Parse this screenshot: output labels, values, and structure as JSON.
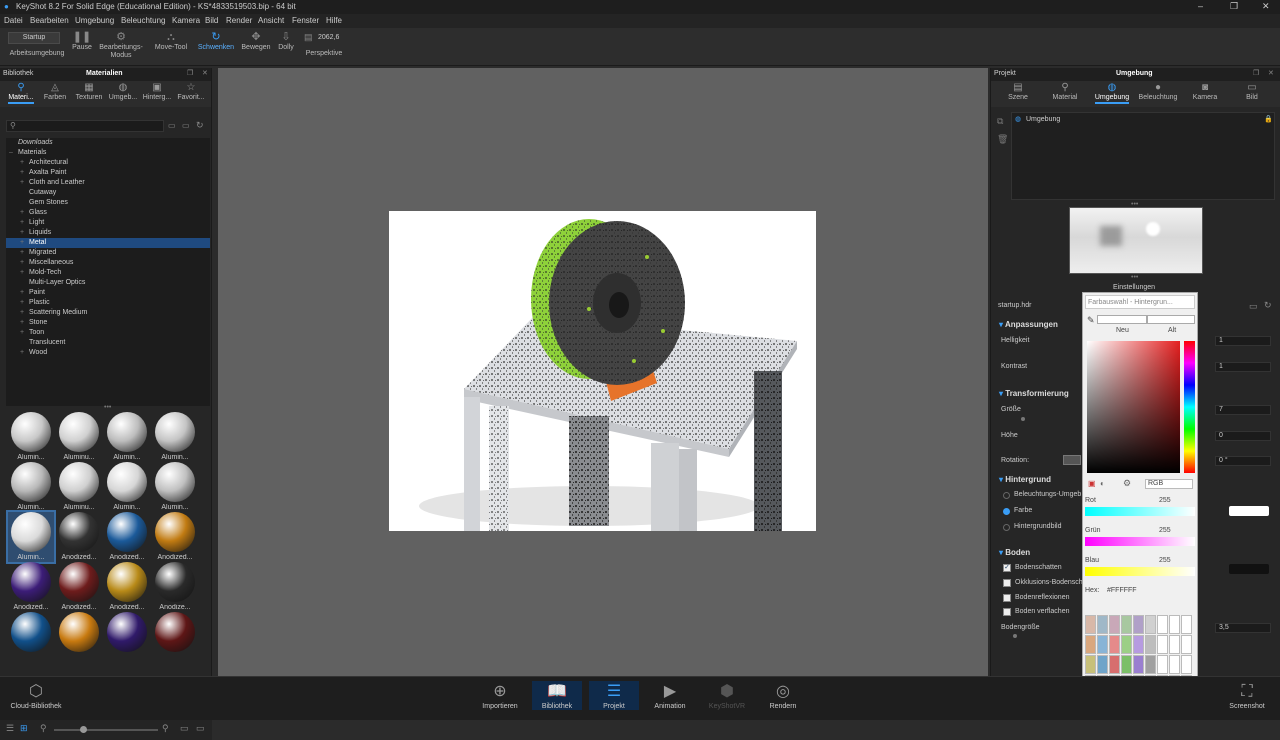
{
  "window": {
    "title": "KeyShot 8.2 For Solid Edge (Educational Edition) - KS*4833519503.bip - 64 bit"
  },
  "menu": [
    "Datei",
    "Bearbeiten",
    "Umgebung",
    "Beleuchtung",
    "Kamera",
    "Bild",
    "Render",
    "Ansicht",
    "Fenster",
    "Hilfe"
  ],
  "toolbar": {
    "startup": "Startup",
    "items": [
      {
        "label": "Arbeitsumgebung",
        "icon": "workspace-icon"
      },
      {
        "label": "Pause",
        "icon": "pause-icon"
      },
      {
        "label": "Bearbeitungs-\nModus",
        "icon": "edit-mode-icon"
      },
      {
        "label": "Move-Tool",
        "icon": "move-tool-icon"
      },
      {
        "label": "Schwenken",
        "icon": "tumble-icon"
      },
      {
        "label": "Bewegen",
        "icon": "pan-icon"
      },
      {
        "label": "Dolly",
        "icon": "dolly-icon"
      },
      {
        "label": "Perspektive",
        "icon": "perspective-icon"
      }
    ],
    "zoom_value": "2062,6"
  },
  "left_panel": {
    "header_left": "Bibliothek",
    "header_title": "Materialien",
    "tabs": [
      {
        "label": "Materi...",
        "icon": "materials-icon"
      },
      {
        "label": "Farben",
        "icon": "colors-icon"
      },
      {
        "label": "Texturen",
        "icon": "textures-icon"
      },
      {
        "label": "Umgeb...",
        "icon": "environments-icon"
      },
      {
        "label": "Hinterg...",
        "icon": "backplates-icon"
      },
      {
        "label": "Favorit...",
        "icon": "favorites-icon"
      }
    ],
    "tree": [
      {
        "label": "Downloads",
        "level": 0,
        "italic": true
      },
      {
        "label": "Materials",
        "level": 0,
        "open": true
      },
      {
        "label": "Architectural",
        "plus": true
      },
      {
        "label": "Axalta Paint",
        "plus": true
      },
      {
        "label": "Cloth and Leather",
        "plus": true
      },
      {
        "label": "Cutaway"
      },
      {
        "label": "Gem Stones"
      },
      {
        "label": "Glass",
        "plus": true
      },
      {
        "label": "Light",
        "plus": true
      },
      {
        "label": "Liquids",
        "plus": true
      },
      {
        "label": "Metal",
        "plus": true,
        "selected": true
      },
      {
        "label": "Migrated",
        "plus": true
      },
      {
        "label": "Miscellaneous",
        "plus": true
      },
      {
        "label": "Mold-Tech",
        "plus": true
      },
      {
        "label": "Multi-Layer Optics"
      },
      {
        "label": "Paint",
        "plus": true
      },
      {
        "label": "Plastic",
        "plus": true
      },
      {
        "label": "Scattering Medium",
        "plus": true
      },
      {
        "label": "Stone",
        "plus": true
      },
      {
        "label": "Toon",
        "plus": true
      },
      {
        "label": "Translucent"
      },
      {
        "label": "Wood",
        "plus": true
      }
    ],
    "thumbnails": [
      {
        "label": "Alumin...",
        "color": "#c8c8c8"
      },
      {
        "label": "Aluminu...",
        "color": "#d0d0d0"
      },
      {
        "label": "Alumin...",
        "color": "#bdbdbd"
      },
      {
        "label": "Alumin...",
        "color": "#c4c4c4"
      },
      {
        "label": "Alumin...",
        "color": "#b8b8b8"
      },
      {
        "label": "Aluminu...",
        "color": "#cfcfcf"
      },
      {
        "label": "Alumin...",
        "color": "#d6d6d6"
      },
      {
        "label": "Alumin...",
        "color": "#c0c0c0"
      },
      {
        "label": "Alumin...",
        "color": "#dadada",
        "selected": true
      },
      {
        "label": "Anodized...",
        "color": "#333333"
      },
      {
        "label": "Anodized...",
        "color": "#1b5a9a"
      },
      {
        "label": "Anodized...",
        "color": "#c17b12"
      },
      {
        "label": "Anodized...",
        "color": "#3c1d78"
      },
      {
        "label": "Anodized...",
        "color": "#6e1c1c"
      },
      {
        "label": "Anodized...",
        "color": "#b88a18"
      },
      {
        "label": "Anodize...",
        "color": "#2a2a2a"
      },
      {
        "label": "",
        "color": "#11508a"
      },
      {
        "label": "",
        "color": "#c87a10"
      },
      {
        "label": "",
        "color": "#301a6a"
      },
      {
        "label": "",
        "color": "#5e1616"
      }
    ]
  },
  "right_panel": {
    "header_left": "Projekt",
    "header_title": "Umgebung",
    "tabs": [
      {
        "label": "Szene",
        "icon": "scene-icon"
      },
      {
        "label": "Material",
        "icon": "material-icon"
      },
      {
        "label": "Umgebung",
        "icon": "environment-icon"
      },
      {
        "label": "Beleuchtung",
        "icon": "lighting-icon"
      },
      {
        "label": "Kamera",
        "icon": "camera-icon"
      },
      {
        "label": "Bild",
        "icon": "image-icon"
      }
    ],
    "env_item": "Umgebung",
    "preview_label": "Einstellungen",
    "hdr_file": "startup.hdr",
    "sections": {
      "anpassungen": "Anpassungen",
      "transformierung": "Transformierung",
      "hintergrund": "Hintergrund",
      "boden": "Boden"
    },
    "fields": {
      "helligkeit": {
        "label": "Helligkeit",
        "value": "1"
      },
      "kontrast": {
        "label": "Kontrast",
        "value": "1"
      },
      "groesse": {
        "label": "Größe",
        "value": "7"
      },
      "hoehe": {
        "label": "Höhe",
        "value": "0"
      },
      "rotation": {
        "label": "Rotation:",
        "value": "0 °"
      },
      "bodengroesse": {
        "label": "Bodengröße",
        "value": "3,5"
      }
    },
    "hintergrund_options": [
      "Beleuchtungs-Umgeb...",
      "Farbe",
      "Hintergrundbild"
    ],
    "boden_options": [
      {
        "label": "Bodenschatten",
        "checked": true
      },
      {
        "label": "Okklusions-Bodensch...",
        "checked": false
      },
      {
        "label": "Bodenreflexionen",
        "checked": false
      },
      {
        "label": "Boden verflachen",
        "checked": false
      }
    ]
  },
  "color_picker": {
    "title": "Farbauswahl - Hintergrun...",
    "neu": "Neu",
    "alt": "Alt",
    "mode": "RGB",
    "rot": {
      "label": "Rot",
      "value": "255"
    },
    "gruen": {
      "label": "Grün",
      "value": "255"
    },
    "blau": {
      "label": "Blau",
      "value": "255"
    },
    "hex_label": "Hex:",
    "hex_value": "#FFFFFF"
  },
  "bottom_bar": {
    "cloud": "Cloud-Bibliothek",
    "items": [
      {
        "label": "Importieren",
        "icon": "import-icon"
      },
      {
        "label": "Bibliothek",
        "icon": "library-icon",
        "active": true
      },
      {
        "label": "Projekt",
        "icon": "project-icon",
        "active": true
      },
      {
        "label": "Animation",
        "icon": "animation-icon"
      },
      {
        "label": "KeyShotVR",
        "icon": "keyshotvr-icon",
        "dim": true
      },
      {
        "label": "Rendern",
        "icon": "render-icon"
      }
    ],
    "screenshot": "Screenshot"
  }
}
